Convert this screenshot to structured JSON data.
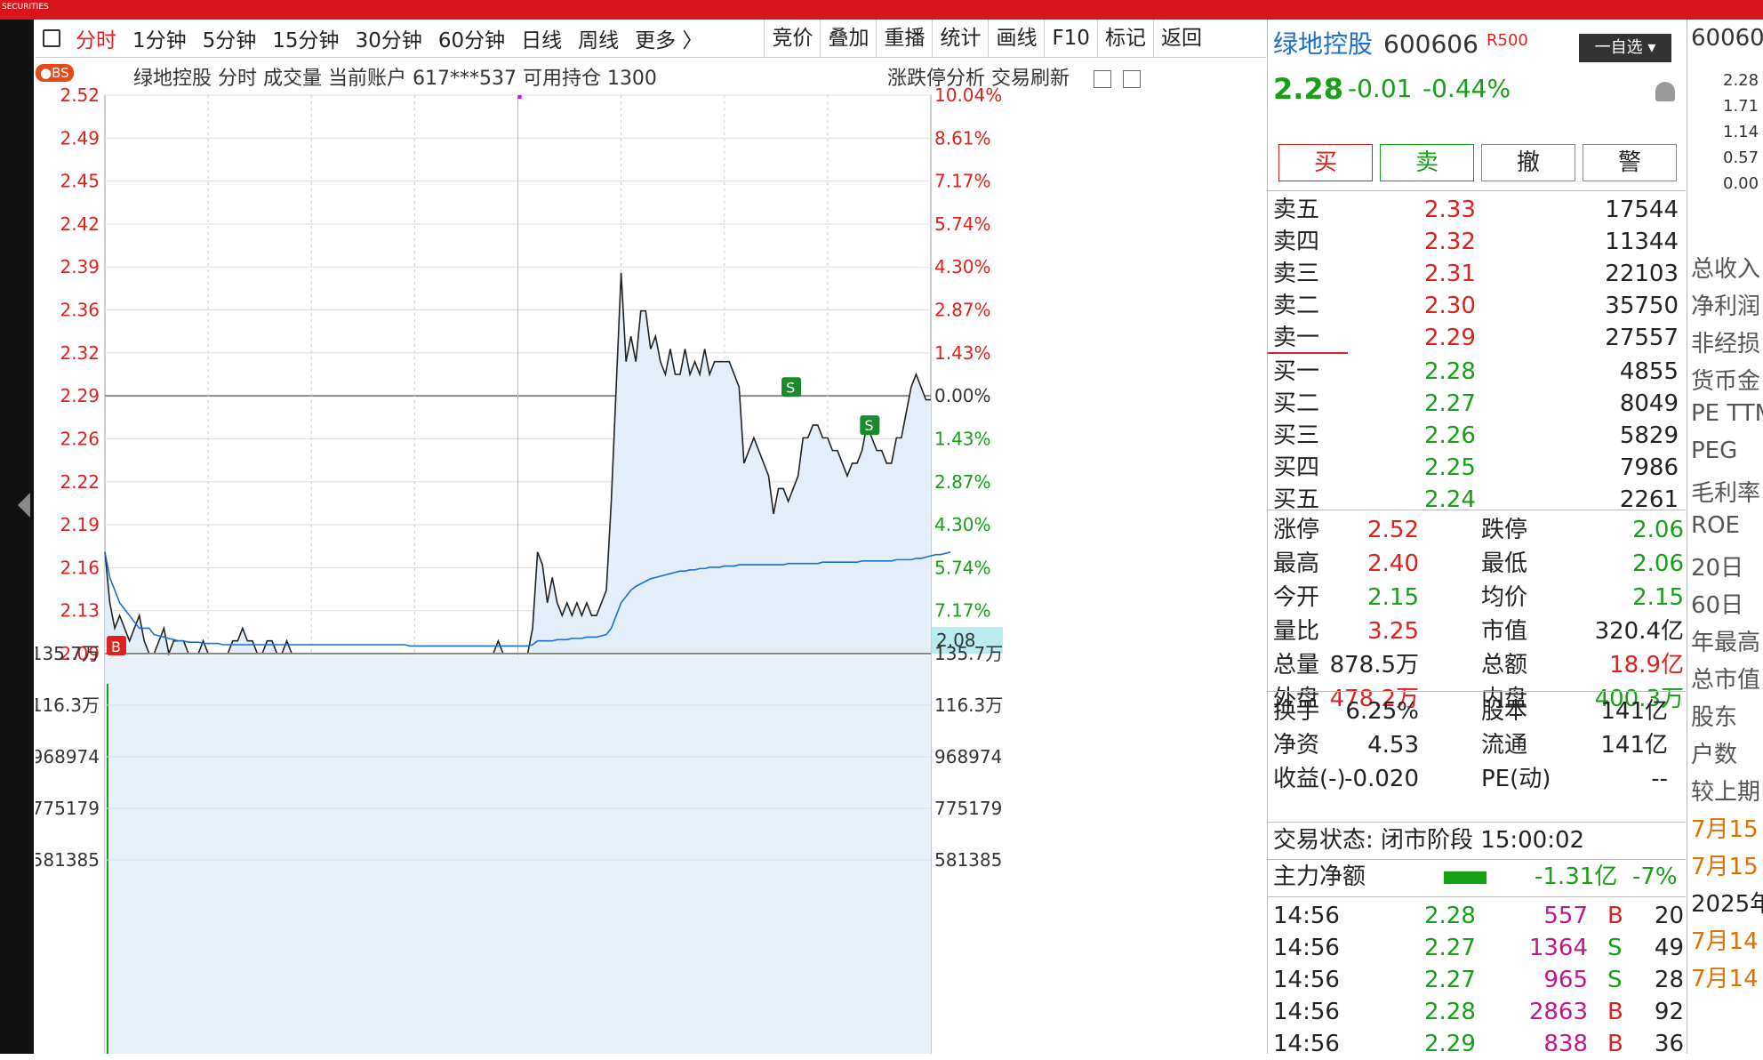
{
  "brand": "SECURITIES",
  "tabs": [
    "分时",
    "1分钟",
    "5分钟",
    "15分钟",
    "30分钟",
    "60分钟",
    "日线",
    "周线",
    "更多 〉"
  ],
  "toolbar": [
    "竞价",
    "叠加",
    "重播",
    "统计",
    "画线",
    "F10",
    "标记",
    "返回"
  ],
  "chart_header": {
    "badge": "●BS",
    "title": "绿地控股   分时 成交量 当前账户 617***537 可用持仓 1300",
    "right": "涨跌停分析   交易刷新"
  },
  "stock": {
    "name": "绿地控股",
    "code": "600606",
    "tag": "R500",
    "watch": "一自选",
    "price": "2.28",
    "change": "-0.01",
    "pct": "-0.44%"
  },
  "actions": [
    "买",
    "卖",
    "撤",
    "警"
  ],
  "asks": [
    [
      "卖五",
      "2.33",
      "17544"
    ],
    [
      "卖四",
      "2.32",
      "11344"
    ],
    [
      "卖三",
      "2.31",
      "22103"
    ],
    [
      "卖二",
      "2.30",
      "35750"
    ],
    [
      "卖一",
      "2.29",
      "27557"
    ]
  ],
  "bids": [
    [
      "买一",
      "2.28",
      "4855"
    ],
    [
      "买二",
      "2.27",
      "8049"
    ],
    [
      "买三",
      "2.26",
      "5829"
    ],
    [
      "买四",
      "2.25",
      "7986"
    ],
    [
      "买五",
      "2.24",
      "2261"
    ]
  ],
  "stats": [
    [
      "涨停",
      "2.52",
      "跌停",
      "2.06"
    ],
    [
      "最高",
      "2.40",
      "最低",
      "2.06"
    ],
    [
      "今开",
      "2.15",
      "均价",
      "2.15"
    ],
    [
      "量比",
      "3.25",
      "市值",
      "320.4亿"
    ],
    [
      "总量",
      "878.5万",
      "总额",
      "18.9亿"
    ],
    [
      "外盘",
      "478.2万",
      "内盘",
      "400.3万"
    ]
  ],
  "stats2": [
    [
      "换手",
      "6.25%",
      "股本",
      "141亿"
    ],
    [
      "净资",
      "4.53",
      "流通",
      "141亿"
    ],
    [
      "收益(-)",
      "-0.020",
      "PE(动)",
      "--"
    ]
  ],
  "status": "交易状态: 闭市阶段 15:00:02",
  "mainflow": {
    "label": "主力净额",
    "value": "-1.31亿",
    "pct": "-7%"
  },
  "trades": [
    [
      "14:56",
      "2.28",
      "557",
      "B",
      "20"
    ],
    [
      "14:56",
      "2.27",
      "1364",
      "S",
      "49"
    ],
    [
      "14:56",
      "2.27",
      "965",
      "S",
      "28"
    ],
    [
      "14:56",
      "2.28",
      "2863",
      "B",
      "92"
    ],
    [
      "14:56",
      "2.29",
      "838",
      "B",
      "36"
    ]
  ],
  "far_right": {
    "code": "60060",
    "nums": [
      "2.28",
      "1.71",
      "1.14",
      "0.57",
      "0.00"
    ],
    "labels": [
      "总收入",
      "净利润",
      "非经损",
      "货币金",
      "PE TTM",
      "PEG",
      "毛利率",
      "ROE",
      "20日",
      "60日",
      "年最高",
      "总市值",
      "股东",
      "户数",
      "较上期",
      "7月15",
      "7月15",
      "2025年",
      "7月14",
      "7月14"
    ]
  },
  "chart_data": {
    "type": "line",
    "price_ticks_left": [
      "2.52",
      "2.49",
      "2.45",
      "2.42",
      "2.39",
      "2.36",
      "2.32",
      "2.29",
      "2.26",
      "2.22",
      "2.19",
      "2.16",
      "2.13",
      "2.09"
    ],
    "pct_ticks_right": [
      "10.04%",
      "8.61%",
      "7.17%",
      "5.74%",
      "4.30%",
      "2.87%",
      "1.43%",
      "0.00%",
      "1.43%",
      "2.87%",
      "4.30%",
      "5.74%",
      "7.17%"
    ],
    "avg_price_label": "2.08",
    "volume_ticks": [
      "135.7万",
      "116.3万",
      "968974",
      "775179",
      "581385"
    ],
    "prev_close": 2.29,
    "ylim": [
      2.08,
      2.52
    ],
    "price": [
      2.16,
      2.12,
      2.1,
      2.11,
      2.1,
      2.09,
      2.1,
      2.11,
      2.09,
      2.08,
      2.08,
      2.09,
      2.1,
      2.08,
      2.09,
      2.09,
      2.09,
      2.08,
      2.08,
      2.08,
      2.09,
      2.08,
      2.08,
      2.08,
      2.08,
      2.08,
      2.09,
      2.09,
      2.1,
      2.09,
      2.09,
      2.08,
      2.08,
      2.09,
      2.09,
      2.08,
      2.08,
      2.09,
      2.08,
      2.08,
      2.08,
      2.08,
      2.08,
      2.08,
      2.08,
      2.08,
      2.08,
      2.08,
      2.08,
      2.08,
      2.08,
      2.08,
      2.08,
      2.08,
      2.08,
      2.08,
      2.08,
      2.08,
      2.08,
      2.08,
      2.08,
      2.08,
      2.08,
      2.08,
      2.08,
      2.08,
      2.08,
      2.08,
      2.08,
      2.08,
      2.08,
      2.08,
      2.08,
      2.08,
      2.08,
      2.08,
      2.08,
      2.08,
      2.08,
      2.08,
      2.09,
      2.08,
      2.08,
      2.08,
      2.08,
      2.08,
      2.08,
      2.1,
      2.16,
      2.15,
      2.12,
      2.14,
      2.12,
      2.11,
      2.12,
      2.11,
      2.12,
      2.11,
      2.12,
      2.11,
      2.11,
      2.12,
      2.13,
      2.2,
      2.29,
      2.38,
      2.31,
      2.33,
      2.31,
      2.35,
      2.35,
      2.32,
      2.33,
      2.31,
      2.3,
      2.32,
      2.3,
      2.3,
      2.32,
      2.3,
      2.31,
      2.3,
      2.32,
      2.3,
      2.31,
      2.31,
      2.31,
      2.31,
      2.3,
      2.29,
      2.23,
      2.24,
      2.25,
      2.24,
      2.23,
      2.22,
      2.19,
      2.21,
      2.21,
      2.2,
      2.21,
      2.22,
      2.25,
      2.25,
      2.26,
      2.26,
      2.25,
      2.25,
      2.24,
      2.24,
      2.23,
      2.22,
      2.23,
      2.23,
      2.24,
      2.26,
      2.25,
      2.24,
      2.24,
      2.23,
      2.23,
      2.25,
      2.25,
      2.27,
      2.29,
      2.3,
      2.29,
      2.28,
      2.28
    ],
    "avg": [
      2.16,
      2.14,
      2.13,
      2.12,
      2.115,
      2.11,
      2.105,
      2.1,
      2.1,
      2.1,
      2.095,
      2.094,
      2.093,
      2.092,
      2.091,
      2.09,
      2.09,
      2.089,
      2.089,
      2.089,
      2.088,
      2.088,
      2.088,
      2.088,
      2.087,
      2.087,
      2.087,
      2.087,
      2.087,
      2.087,
      2.087,
      2.087,
      2.087,
      2.087,
      2.087,
      2.087,
      2.087,
      2.087,
      2.087,
      2.087,
      2.087,
      2.087,
      2.087,
      2.087,
      2.087,
      2.087,
      2.087,
      2.087,
      2.087,
      2.087,
      2.087,
      2.087,
      2.087,
      2.087,
      2.087,
      2.087,
      2.087,
      2.087,
      2.087,
      2.087,
      2.087,
      2.087,
      2.086,
      2.086,
      2.086,
      2.086,
      2.086,
      2.086,
      2.086,
      2.086,
      2.086,
      2.086,
      2.086,
      2.086,
      2.086,
      2.086,
      2.086,
      2.086,
      2.086,
      2.086,
      2.086,
      2.086,
      2.086,
      2.086,
      2.086,
      2.086,
      2.086,
      2.087,
      2.09,
      2.09,
      2.09,
      2.09,
      2.091,
      2.091,
      2.091,
      2.092,
      2.092,
      2.092,
      2.093,
      2.093,
      2.093,
      2.094,
      2.095,
      2.1,
      2.11,
      2.12,
      2.125,
      2.13,
      2.133,
      2.135,
      2.137,
      2.139,
      2.14,
      2.141,
      2.142,
      2.143,
      2.144,
      2.145,
      2.145,
      2.146,
      2.146,
      2.147,
      2.147,
      2.148,
      2.148,
      2.148,
      2.149,
      2.149,
      2.149,
      2.15,
      2.15,
      2.15,
      2.15,
      2.15,
      2.15,
      2.15,
      2.15,
      2.15,
      2.15,
      2.151,
      2.151,
      2.151,
      2.151,
      2.151,
      2.151,
      2.151,
      2.152,
      2.152,
      2.152,
      2.152,
      2.152,
      2.152,
      2.152,
      2.152,
      2.153,
      2.153,
      2.153,
      2.153,
      2.153,
      2.153,
      2.153,
      2.154,
      2.154,
      2.154,
      2.154,
      2.155,
      2.155,
      2.156,
      2.157,
      2.158,
      2.158,
      2.159,
      2.16
    ]
  }
}
